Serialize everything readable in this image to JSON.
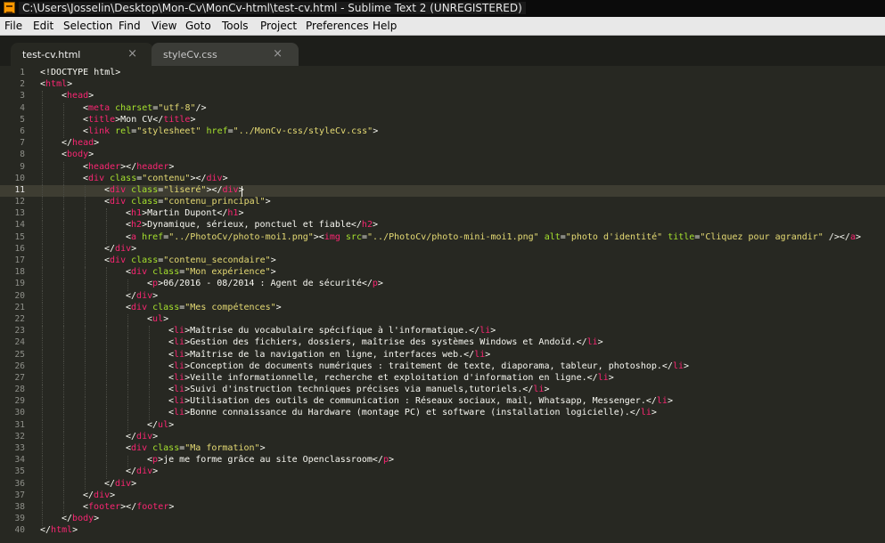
{
  "window": {
    "title": "C:\\Users\\Josselin\\Desktop\\Mon-Cv\\MonCv-html\\test-cv.html - Sublime Text 2 (UNREGISTERED)",
    "app_icon": "sublime-text-icon"
  },
  "menu": [
    "File",
    "Edit",
    "Selection",
    "Find",
    "View",
    "Goto",
    "Tools",
    "Project",
    "Preferences",
    "Help"
  ],
  "tabs": [
    {
      "label": "test-cv.html",
      "active": true,
      "close": "×"
    },
    {
      "label": "styleCv.css",
      "active": false,
      "close": "×"
    }
  ],
  "editor": {
    "current_line": 11,
    "colors": {
      "background": "#272822",
      "tag": "#f92672",
      "attribute": "#a6e22e",
      "string": "#e6db74",
      "text": "#f8f8f2"
    },
    "lines": [
      {
        "n": "1",
        "indent": 0,
        "tokens": [
          [
            "plain",
            "<!DOCTYPE html>"
          ]
        ]
      },
      {
        "n": "2",
        "indent": 0,
        "tokens": [
          [
            "plain",
            "<"
          ],
          [
            "tag",
            "html"
          ],
          [
            "plain",
            ">"
          ]
        ]
      },
      {
        "n": "3",
        "indent": 1,
        "tokens": [
          [
            "plain",
            "<"
          ],
          [
            "tag",
            "head"
          ],
          [
            "plain",
            ">"
          ]
        ]
      },
      {
        "n": "4",
        "indent": 2,
        "tokens": [
          [
            "plain",
            "<"
          ],
          [
            "tag",
            "meta"
          ],
          [
            "plain",
            " "
          ],
          [
            "attr",
            "charset"
          ],
          [
            "plain",
            "="
          ],
          [
            "str",
            "\"utf-8\""
          ],
          [
            "plain",
            "/>"
          ]
        ]
      },
      {
        "n": "5",
        "indent": 2,
        "tokens": [
          [
            "plain",
            "<"
          ],
          [
            "tag",
            "title"
          ],
          [
            "plain",
            ">Mon CV</"
          ],
          [
            "tag",
            "title"
          ],
          [
            "plain",
            ">"
          ]
        ]
      },
      {
        "n": "6",
        "indent": 2,
        "tokens": [
          [
            "plain",
            "<"
          ],
          [
            "tag",
            "link"
          ],
          [
            "plain",
            " "
          ],
          [
            "attr",
            "rel"
          ],
          [
            "plain",
            "="
          ],
          [
            "str",
            "\"stylesheet\""
          ],
          [
            "plain",
            " "
          ],
          [
            "attr",
            "href"
          ],
          [
            "plain",
            "="
          ],
          [
            "str",
            "\"../MonCv-css/styleCv.css\""
          ],
          [
            "plain",
            ">"
          ]
        ]
      },
      {
        "n": "7",
        "indent": 1,
        "tokens": [
          [
            "plain",
            "</"
          ],
          [
            "tag",
            "head"
          ],
          [
            "plain",
            ">"
          ]
        ]
      },
      {
        "n": "8",
        "indent": 1,
        "tokens": [
          [
            "plain",
            "<"
          ],
          [
            "tag",
            "body"
          ],
          [
            "plain",
            ">"
          ]
        ]
      },
      {
        "n": "9",
        "indent": 2,
        "tokens": [
          [
            "plain",
            "<"
          ],
          [
            "tag",
            "header"
          ],
          [
            "plain",
            "></"
          ],
          [
            "tag",
            "header"
          ],
          [
            "plain",
            ">"
          ]
        ]
      },
      {
        "n": "10",
        "indent": 2,
        "tokens": [
          [
            "plain",
            "<"
          ],
          [
            "tag",
            "div"
          ],
          [
            "plain",
            " "
          ],
          [
            "attr",
            "class"
          ],
          [
            "plain",
            "="
          ],
          [
            "str",
            "\"contenu\""
          ],
          [
            "plain",
            "></"
          ],
          [
            "tag",
            "div"
          ],
          [
            "plain",
            ">"
          ]
        ]
      },
      {
        "n": "11",
        "indent": 3,
        "tokens": [
          [
            "plain",
            "<"
          ],
          [
            "tag",
            "div"
          ],
          [
            "plain",
            " "
          ],
          [
            "attr",
            "class"
          ],
          [
            "plain",
            "="
          ],
          [
            "str",
            "\"liseré\""
          ],
          [
            "plain",
            "></"
          ],
          [
            "tag",
            "div"
          ],
          [
            "plain",
            ">"
          ]
        ]
      },
      {
        "n": "12",
        "indent": 3,
        "tokens": [
          [
            "plain",
            "<"
          ],
          [
            "tag",
            "div"
          ],
          [
            "plain",
            " "
          ],
          [
            "attr",
            "class"
          ],
          [
            "plain",
            "="
          ],
          [
            "str",
            "\"contenu_principal\""
          ],
          [
            "plain",
            ">"
          ]
        ]
      },
      {
        "n": "13",
        "indent": 4,
        "tokens": [
          [
            "plain",
            "<"
          ],
          [
            "tag",
            "h1"
          ],
          [
            "plain",
            ">Martin Dupont</"
          ],
          [
            "tag",
            "h1"
          ],
          [
            "plain",
            ">"
          ]
        ]
      },
      {
        "n": "14",
        "indent": 4,
        "tokens": [
          [
            "plain",
            "<"
          ],
          [
            "tag",
            "h2"
          ],
          [
            "plain",
            ">Dynamique, sérieux, ponctuel et fiable</"
          ],
          [
            "tag",
            "h2"
          ],
          [
            "plain",
            ">"
          ]
        ]
      },
      {
        "n": "15",
        "indent": 4,
        "tokens": [
          [
            "plain",
            "<"
          ],
          [
            "tag",
            "a"
          ],
          [
            "plain",
            " "
          ],
          [
            "attr",
            "href"
          ],
          [
            "plain",
            "="
          ],
          [
            "str",
            "\"../PhotoCv/photo-moi1.png\""
          ],
          [
            "plain",
            "><"
          ],
          [
            "tag",
            "img"
          ],
          [
            "plain",
            " "
          ],
          [
            "attr",
            "src"
          ],
          [
            "plain",
            "="
          ],
          [
            "str",
            "\"../PhotoCv/photo-mini-moi1.png\""
          ],
          [
            "plain",
            " "
          ],
          [
            "attr",
            "alt"
          ],
          [
            "plain",
            "="
          ],
          [
            "str",
            "\"photo d'identité\""
          ],
          [
            "plain",
            " "
          ],
          [
            "attr",
            "title"
          ],
          [
            "plain",
            "="
          ],
          [
            "str",
            "\"Cliquez pour agrandir\""
          ],
          [
            "plain",
            " /></"
          ],
          [
            "tag",
            "a"
          ],
          [
            "plain",
            ">"
          ]
        ]
      },
      {
        "n": "16",
        "indent": 3,
        "tokens": [
          [
            "plain",
            "</"
          ],
          [
            "tag",
            "div"
          ],
          [
            "plain",
            ">"
          ]
        ]
      },
      {
        "n": "17",
        "indent": 3,
        "tokens": [
          [
            "plain",
            "<"
          ],
          [
            "tag",
            "div"
          ],
          [
            "plain",
            " "
          ],
          [
            "attr",
            "class"
          ],
          [
            "plain",
            "="
          ],
          [
            "str",
            "\"contenu_secondaire\""
          ],
          [
            "plain",
            ">"
          ]
        ]
      },
      {
        "n": "18",
        "indent": 4,
        "tokens": [
          [
            "plain",
            "<"
          ],
          [
            "tag",
            "div"
          ],
          [
            "plain",
            " "
          ],
          [
            "attr",
            "class"
          ],
          [
            "plain",
            "="
          ],
          [
            "str",
            "\"Mon expérience\""
          ],
          [
            "plain",
            ">"
          ]
        ]
      },
      {
        "n": "19",
        "indent": 5,
        "tokens": [
          [
            "plain",
            "<"
          ],
          [
            "tag",
            "p"
          ],
          [
            "plain",
            ">06/2016 - 08/2014 : Agent de sécurité</"
          ],
          [
            "tag",
            "p"
          ],
          [
            "plain",
            ">"
          ]
        ]
      },
      {
        "n": "20",
        "indent": 4,
        "tokens": [
          [
            "plain",
            "</"
          ],
          [
            "tag",
            "div"
          ],
          [
            "plain",
            ">"
          ]
        ]
      },
      {
        "n": "21",
        "indent": 4,
        "tokens": [
          [
            "plain",
            "<"
          ],
          [
            "tag",
            "div"
          ],
          [
            "plain",
            " "
          ],
          [
            "attr",
            "class"
          ],
          [
            "plain",
            "="
          ],
          [
            "str",
            "\"Mes compétences\""
          ],
          [
            "plain",
            ">"
          ]
        ]
      },
      {
        "n": "22",
        "indent": 5,
        "tokens": [
          [
            "plain",
            "<"
          ],
          [
            "tag",
            "ul"
          ],
          [
            "plain",
            ">"
          ]
        ]
      },
      {
        "n": "23",
        "indent": 6,
        "tokens": [
          [
            "plain",
            "<"
          ],
          [
            "tag",
            "li"
          ],
          [
            "plain",
            ">Maîtrise du vocabulaire spécifique à l'informatique.</"
          ],
          [
            "tag",
            "li"
          ],
          [
            "plain",
            ">"
          ]
        ]
      },
      {
        "n": "24",
        "indent": 6,
        "tokens": [
          [
            "plain",
            "<"
          ],
          [
            "tag",
            "li"
          ],
          [
            "plain",
            ">Gestion des fichiers, dossiers, maîtrise des systèmes Windows et Andoïd.</"
          ],
          [
            "tag",
            "li"
          ],
          [
            "plain",
            ">"
          ]
        ]
      },
      {
        "n": "25",
        "indent": 6,
        "tokens": [
          [
            "plain",
            "<"
          ],
          [
            "tag",
            "li"
          ],
          [
            "plain",
            ">Maîtrise de la navigation en ligne, interfaces web.</"
          ],
          [
            "tag",
            "li"
          ],
          [
            "plain",
            ">"
          ]
        ]
      },
      {
        "n": "26",
        "indent": 6,
        "tokens": [
          [
            "plain",
            "<"
          ],
          [
            "tag",
            "li"
          ],
          [
            "plain",
            ">Conception de documents numériques : traitement de texte, diaporama, tableur, photoshop.</"
          ],
          [
            "tag",
            "li"
          ],
          [
            "plain",
            ">"
          ]
        ]
      },
      {
        "n": "27",
        "indent": 6,
        "tokens": [
          [
            "plain",
            "<"
          ],
          [
            "tag",
            "li"
          ],
          [
            "plain",
            ">Veille informationnelle, recherche et exploitation d'information en ligne.</"
          ],
          [
            "tag",
            "li"
          ],
          [
            "plain",
            ">"
          ]
        ]
      },
      {
        "n": "28",
        "indent": 6,
        "tokens": [
          [
            "plain",
            "<"
          ],
          [
            "tag",
            "li"
          ],
          [
            "plain",
            ">Suivi d'instruction techniques précises via manuels,tutoriels.</"
          ],
          [
            "tag",
            "li"
          ],
          [
            "plain",
            ">"
          ]
        ]
      },
      {
        "n": "29",
        "indent": 6,
        "tokens": [
          [
            "plain",
            "<"
          ],
          [
            "tag",
            "li"
          ],
          [
            "plain",
            ">Utilisation des outils de communication : Réseaux sociaux, mail, Whatsapp, Messenger.</"
          ],
          [
            "tag",
            "li"
          ],
          [
            "plain",
            ">"
          ]
        ]
      },
      {
        "n": "30",
        "indent": 6,
        "tokens": [
          [
            "plain",
            "<"
          ],
          [
            "tag",
            "li"
          ],
          [
            "plain",
            ">Bonne connaissance du Hardware (montage PC) et software (installation logicielle).</"
          ],
          [
            "tag",
            "li"
          ],
          [
            "plain",
            ">"
          ]
        ]
      },
      {
        "n": "31",
        "indent": 5,
        "tokens": [
          [
            "plain",
            "</"
          ],
          [
            "tag",
            "ul"
          ],
          [
            "plain",
            ">"
          ]
        ]
      },
      {
        "n": "32",
        "indent": 4,
        "tokens": [
          [
            "plain",
            "</"
          ],
          [
            "tag",
            "div"
          ],
          [
            "plain",
            ">"
          ]
        ]
      },
      {
        "n": "33",
        "indent": 4,
        "tokens": [
          [
            "plain",
            "<"
          ],
          [
            "tag",
            "div"
          ],
          [
            "plain",
            " "
          ],
          [
            "attr",
            "class"
          ],
          [
            "plain",
            "="
          ],
          [
            "str",
            "\"Ma formation\""
          ],
          [
            "plain",
            ">"
          ]
        ]
      },
      {
        "n": "34",
        "indent": 5,
        "tokens": [
          [
            "plain",
            "<"
          ],
          [
            "tag",
            "p"
          ],
          [
            "plain",
            ">je me forme grâce au site Openclassroom</"
          ],
          [
            "tag",
            "p"
          ],
          [
            "plain",
            ">"
          ]
        ]
      },
      {
        "n": "35",
        "indent": 4,
        "tokens": [
          [
            "plain",
            "</"
          ],
          [
            "tag",
            "div"
          ],
          [
            "plain",
            ">"
          ]
        ]
      },
      {
        "n": "36",
        "indent": 3,
        "tokens": [
          [
            "plain",
            "</"
          ],
          [
            "tag",
            "div"
          ],
          [
            "plain",
            ">"
          ]
        ]
      },
      {
        "n": "37",
        "indent": 2,
        "tokens": [
          [
            "plain",
            "</"
          ],
          [
            "tag",
            "div"
          ],
          [
            "plain",
            ">"
          ]
        ]
      },
      {
        "n": "38",
        "indent": 2,
        "tokens": [
          [
            "plain",
            "<"
          ],
          [
            "tag",
            "footer"
          ],
          [
            "plain",
            "></"
          ],
          [
            "tag",
            "footer"
          ],
          [
            "plain",
            ">"
          ]
        ]
      },
      {
        "n": "39",
        "indent": 1,
        "tokens": [
          [
            "plain",
            "</"
          ],
          [
            "tag",
            "body"
          ],
          [
            "plain",
            ">"
          ]
        ]
      },
      {
        "n": "40",
        "indent": 0,
        "tokens": [
          [
            "plain",
            "</"
          ],
          [
            "tag",
            "html"
          ],
          [
            "plain",
            ">"
          ]
        ]
      }
    ]
  }
}
